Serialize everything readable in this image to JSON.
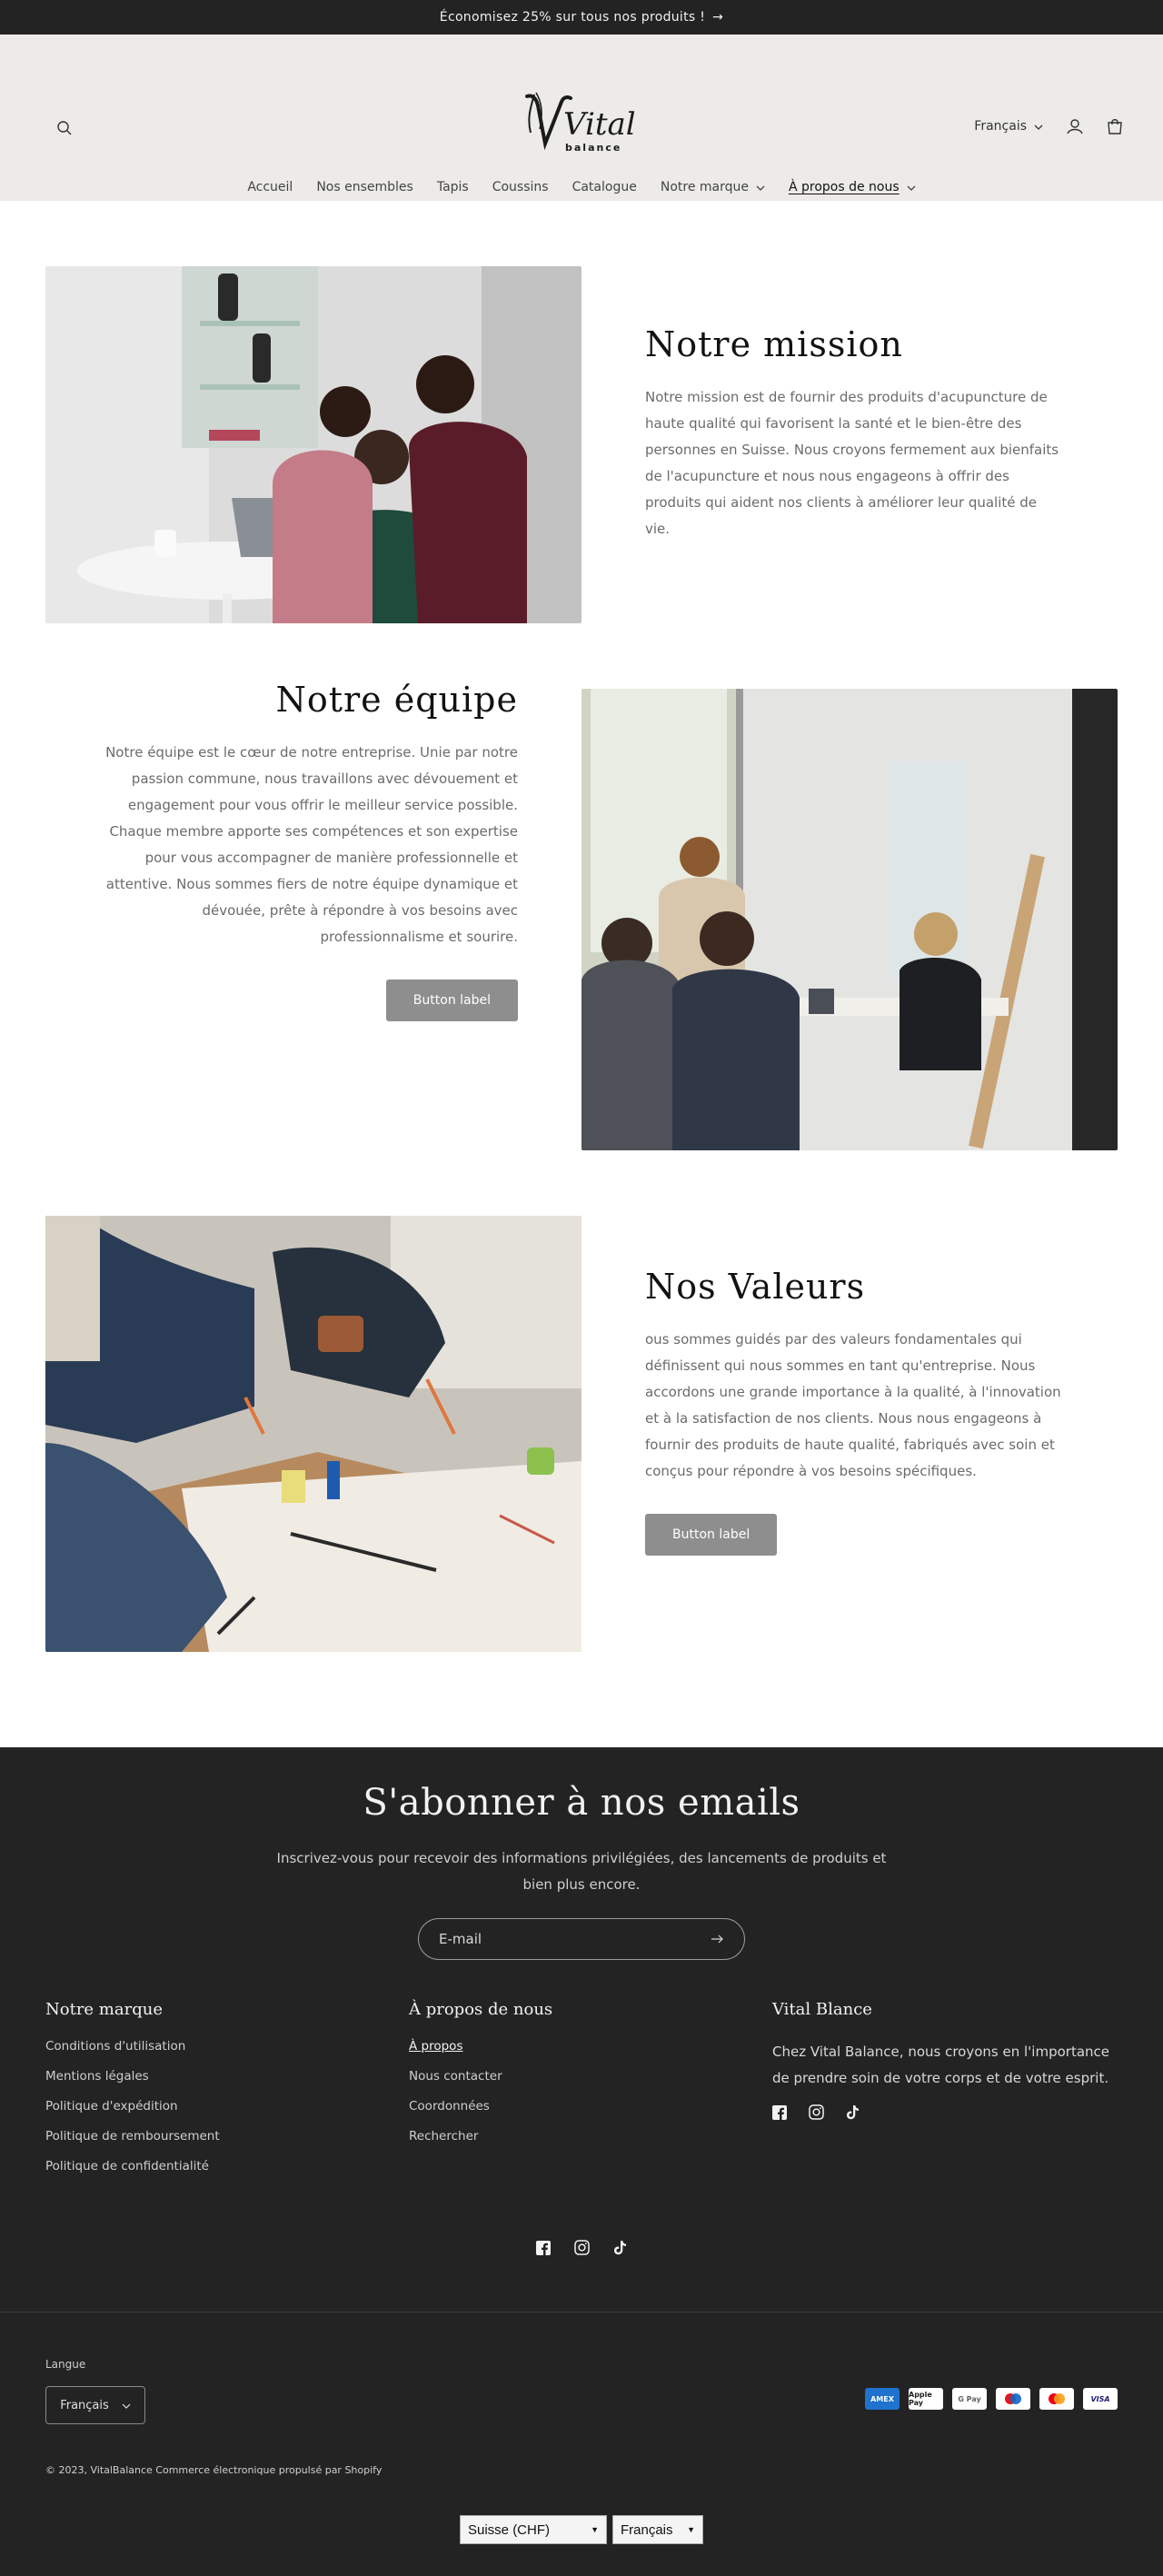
{
  "announcement": {
    "text": "Économisez 25% sur tous nos produits !",
    "arrow": "→"
  },
  "header": {
    "logo_text": "Vital",
    "logo_sub": "balance",
    "language": "Français",
    "nav": [
      {
        "label": "Accueil"
      },
      {
        "label": "Nos ensembles"
      },
      {
        "label": "Tapis"
      },
      {
        "label": "Coussins"
      },
      {
        "label": "Catalogue"
      },
      {
        "label": "Notre marque"
      },
      {
        "label": "À propos de nous"
      }
    ],
    "icons": [
      "search-icon",
      "account-icon",
      "cart-icon"
    ]
  },
  "sections": {
    "mission": {
      "title": "Notre mission",
      "text": "Notre mission est de fournir des produits d'acupuncture de haute qualité qui favorisent la santé et le bien-être des personnes en Suisse. Nous croyons fermement aux bienfaits de l'acupuncture et nous nous engageons à offrir des produits qui aident nos clients à améliorer leur qualité de vie."
    },
    "team": {
      "title": "Notre équipe",
      "text": "Notre équipe est le cœur de notre entreprise. Unie par notre passion commune, nous travaillons avec dévouement et engagement pour vous offrir le meilleur service possible. Chaque membre apporte ses compétences et son expertise pour vous accompagner de manière professionnelle et attentive. Nous sommes fiers de notre équipe dynamique et dévouée, prête à répondre à vos besoins avec professionnalisme et sourire.",
      "button": "Button label"
    },
    "values": {
      "title": "Nos Valeurs",
      "text": "ous sommes guidés par des valeurs fondamentales qui définissent qui nous sommes en tant qu'entreprise. Nous accordons une grande importance à la qualité, à l'innovation et à la satisfaction de nos clients. Nous nous engageons à fournir des produits de haute qualité, fabriqués avec soin et conçus pour répondre à vos besoins spécifiques.",
      "button": "Button label"
    }
  },
  "footer": {
    "subscribe_title": "S'abonner à nos emails",
    "subscribe_text": "Inscrivez-vous pour recevoir des informations privilégiées, des lancements de produits et bien plus encore.",
    "email_placeholder": "E-mail",
    "col1": {
      "title": "Notre marque",
      "links": [
        "Conditions d'utilisation",
        "Mentions légales",
        "Politique d'expédition",
        "Politique de remboursement",
        "Politique de confidentialité"
      ]
    },
    "col2": {
      "title": "À propos de nous",
      "links": [
        "À propos",
        "Nous contacter",
        "Coordonnées",
        "Rechercher"
      ]
    },
    "col3": {
      "title": "Vital Blance",
      "text": "Chez Vital Balance, nous croyons en l'importance de prendre soin de votre corps et de votre esprit."
    },
    "social_icons": [
      "facebook-icon",
      "instagram-icon",
      "tiktok-icon"
    ],
    "language_label": "Langue",
    "language_value": "Français",
    "payments": [
      "AMEX",
      "Apple Pay",
      "G Pay",
      "Maestro",
      "Mastercard",
      "VISA"
    ],
    "copyright": "© 2023, VitalBalance Commerce électronique propulsé par Shopify",
    "currency_select": "Suisse (CHF)",
    "language_select": "Français"
  },
  "colors": {
    "dark": "#232323",
    "header_bg": "#ecebe8",
    "button": "#8e8e8e"
  }
}
